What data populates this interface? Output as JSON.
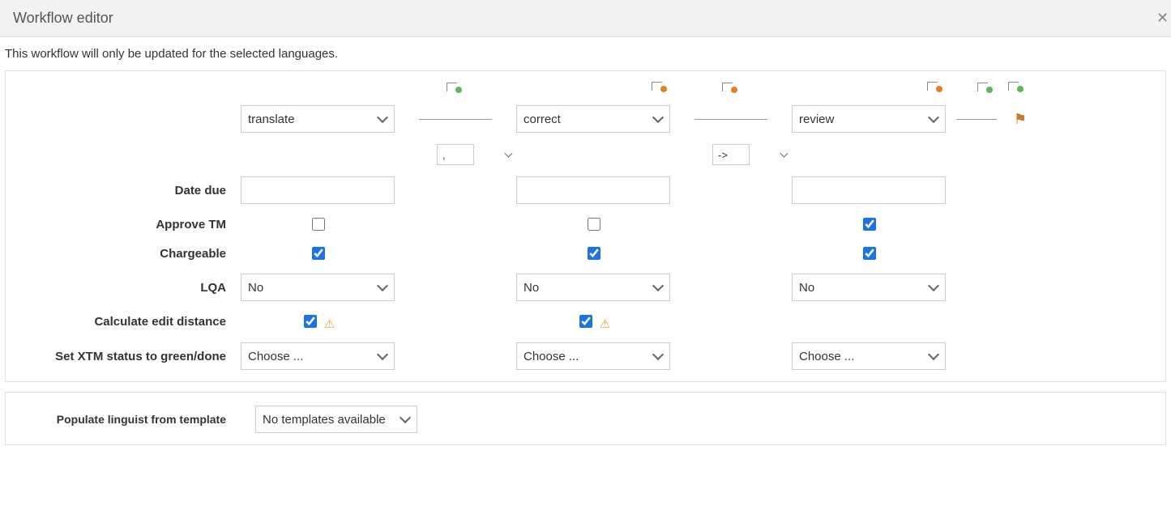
{
  "header": {
    "title": "Workflow editor"
  },
  "notice": "This workflow will only be updated for the selected languages.",
  "labels": {
    "date_due": "Date due",
    "approve_tm": "Approve TM",
    "chargeable": "Chargeable",
    "lqa": "LQA",
    "calc_edit": "Calculate edit distance",
    "set_status": "Set XTM status to green/done",
    "populate": "Populate linguist from template"
  },
  "steps": [
    {
      "name": "translate",
      "date_due": "",
      "approve_tm": false,
      "chargeable": true,
      "lqa": "No",
      "calc_edit": true,
      "calc_edit_warn": true,
      "set_status": "Choose ..."
    },
    {
      "name": "correct",
      "date_due": "",
      "approve_tm": false,
      "chargeable": true,
      "lqa": "No",
      "calc_edit": true,
      "calc_edit_warn": true,
      "set_status": "Choose ..."
    },
    {
      "name": "review",
      "date_due": "",
      "approve_tm": true,
      "chargeable": true,
      "lqa": "No",
      "calc_edit": false,
      "calc_edit_warn": false,
      "set_status": "Choose ..."
    }
  ],
  "connectors": [
    {
      "dot": "green",
      "sep": ","
    },
    {
      "dot": "orange",
      "sep": null
    },
    {
      "dot": "green",
      "sep": "->"
    },
    {
      "dot": "orange",
      "sep": null
    },
    {
      "dot": "green",
      "sep": null
    }
  ],
  "populate_template": {
    "selected": "No templates available"
  }
}
